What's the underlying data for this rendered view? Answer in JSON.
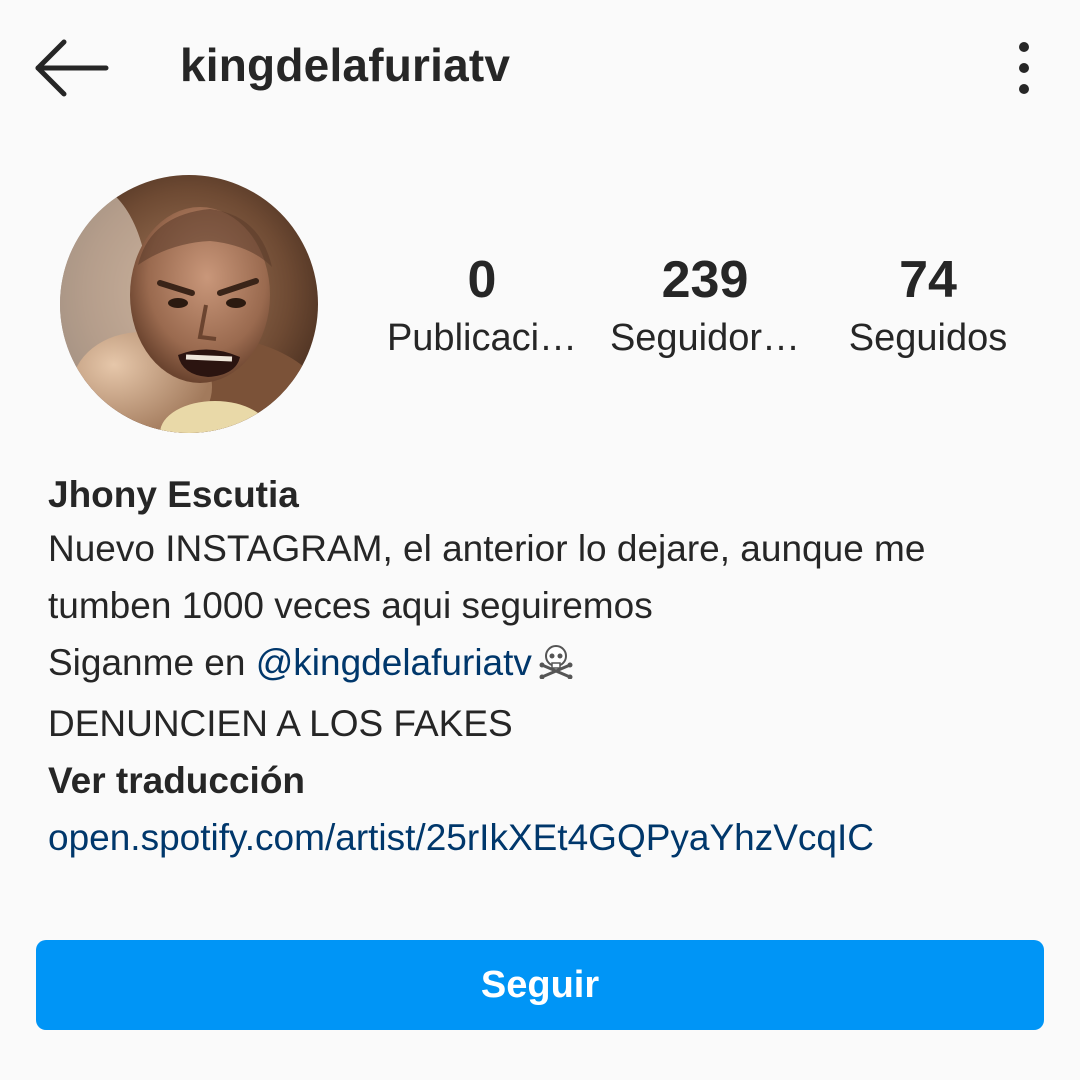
{
  "header": {
    "back_icon": "arrow-left-icon",
    "username": "kingdelafuriatv",
    "more_icon": "vertical-dots-icon"
  },
  "profile": {
    "avatar_icon": "profile-photo",
    "stats": {
      "posts": {
        "value": "0",
        "label": "Publicaci…"
      },
      "followers": {
        "value": "239",
        "label": "Seguidor…"
      },
      "following": {
        "value": "74",
        "label": "Seguidos"
      }
    }
  },
  "bio": {
    "name": "Jhony Escutia",
    "line1": "Nuevo INSTAGRAM, el anterior lo dejare, aunque me",
    "line2": "tumben 1000 veces aqui seguiremos",
    "follow_prefix": "Siganme en ",
    "mention": "@kingdelafuriatv",
    "skull_icon": "skull-crossbones-icon",
    "line4": "DENUNCIEN A LOS FAKES",
    "translate": "Ver traducción",
    "website": "open.spotify.com/artist/25rIkXEt4GQPyaYhzVcqIC"
  },
  "actions": {
    "follow_label": "Seguir"
  },
  "colors": {
    "background": "#fafafa",
    "text": "#262626",
    "link": "#00376b",
    "button": "#0095f6"
  }
}
